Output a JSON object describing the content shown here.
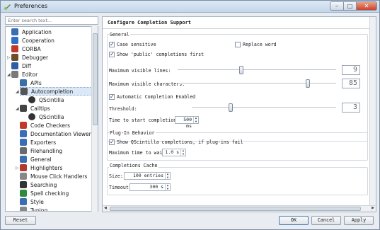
{
  "window": {
    "title": "Preferences"
  },
  "search": {
    "placeholder": "Enter search text..."
  },
  "tree": {
    "items": [
      {
        "label": "Application",
        "icon": "application-icon",
        "color": "#3b6db3"
      },
      {
        "label": "Cooperation",
        "icon": "cooperation-icon",
        "color": "#2f6fc4"
      },
      {
        "label": "CORBA",
        "icon": "corba-icon",
        "color": "#c0392b"
      },
      {
        "label": "Debugger",
        "icon": "debugger-icon",
        "color": "#6b4f2a"
      },
      {
        "label": "Diff",
        "icon": "diff-icon",
        "color": "#2d5da8"
      },
      {
        "label": "Editor",
        "icon": "editor-icon",
        "color": "#7a7a7a"
      },
      {
        "label": "APIs",
        "icon": "apis-icon",
        "color": "#3a6fa8"
      },
      {
        "label": "Autocompletion",
        "icon": "autocompletion-icon",
        "color": "#555555"
      },
      {
        "label": "QScintilla",
        "icon": "qscintilla-icon",
        "color": "#333333"
      },
      {
        "label": "Calltips",
        "icon": "calltips-icon",
        "color": "#444444"
      },
      {
        "label": "QScintilla",
        "icon": "qscintilla-icon",
        "color": "#333333"
      },
      {
        "label": "Code Checkers",
        "icon": "code-checkers-icon",
        "color": "#c0392b"
      },
      {
        "label": "Documentation Viewer",
        "icon": "documentation-viewer-icon",
        "color": "#3b6db3"
      },
      {
        "label": "Exporters",
        "icon": "exporters-icon",
        "color": "#3b6db3"
      },
      {
        "label": "Filehandling",
        "icon": "filehandling-icon",
        "color": "#6a6a6a"
      },
      {
        "label": "General",
        "icon": "general-icon",
        "color": "#3b6db3"
      },
      {
        "label": "Highlighters",
        "icon": "highlighters-icon",
        "color": "#b03a2e"
      },
      {
        "label": "Mouse Click Handlers",
        "icon": "mouse-icon",
        "color": "#888888"
      },
      {
        "label": "Searching",
        "icon": "searching-icon",
        "color": "#333333"
      },
      {
        "label": "Spell checking",
        "icon": "spell-checking-icon",
        "color": "#2e8b3d"
      },
      {
        "label": "Style",
        "icon": "style-icon",
        "color": "#3b6db3"
      },
      {
        "label": "Typing",
        "icon": "typing-icon",
        "color": "#888888"
      }
    ]
  },
  "panel": {
    "title": "Configure Completion Support",
    "general": {
      "label": "General",
      "case_sensitive": "Case sensitive",
      "replace_word": "Replace word",
      "show_public": "Show 'public' completions first",
      "max_visible_lines_label": "Maximum visible lines:",
      "max_visible_lines": "9",
      "max_visible_lines_fraction": 0.4,
      "max_visible_chars_label": "Maximum visible characters:",
      "max_visible_chars": "85",
      "max_visible_chars_fraction": 0.82,
      "auto_enabled": "Automatic Completion Enabled",
      "threshold_label": "Threshold:",
      "threshold": "3",
      "threshold_fraction": 0.27,
      "time_label": "Time to start completion:",
      "time_value": "500 ms"
    },
    "plugin": {
      "label": "Plug-In Behavior",
      "show_qscintilla": "Show QScintilla completions, if plug-ins fail",
      "max_wait_label": "Maximum time to wait:",
      "max_wait_value": "1.0 s"
    },
    "cache": {
      "label": "Completions Cache",
      "size_label": "Size:",
      "size_value": "100 entries",
      "timeout_label": "Timeout:",
      "timeout_value": "300 s"
    }
  },
  "buttons": {
    "reset": "Reset",
    "ok": "OK",
    "cancel": "Cancel",
    "apply": "Apply"
  }
}
